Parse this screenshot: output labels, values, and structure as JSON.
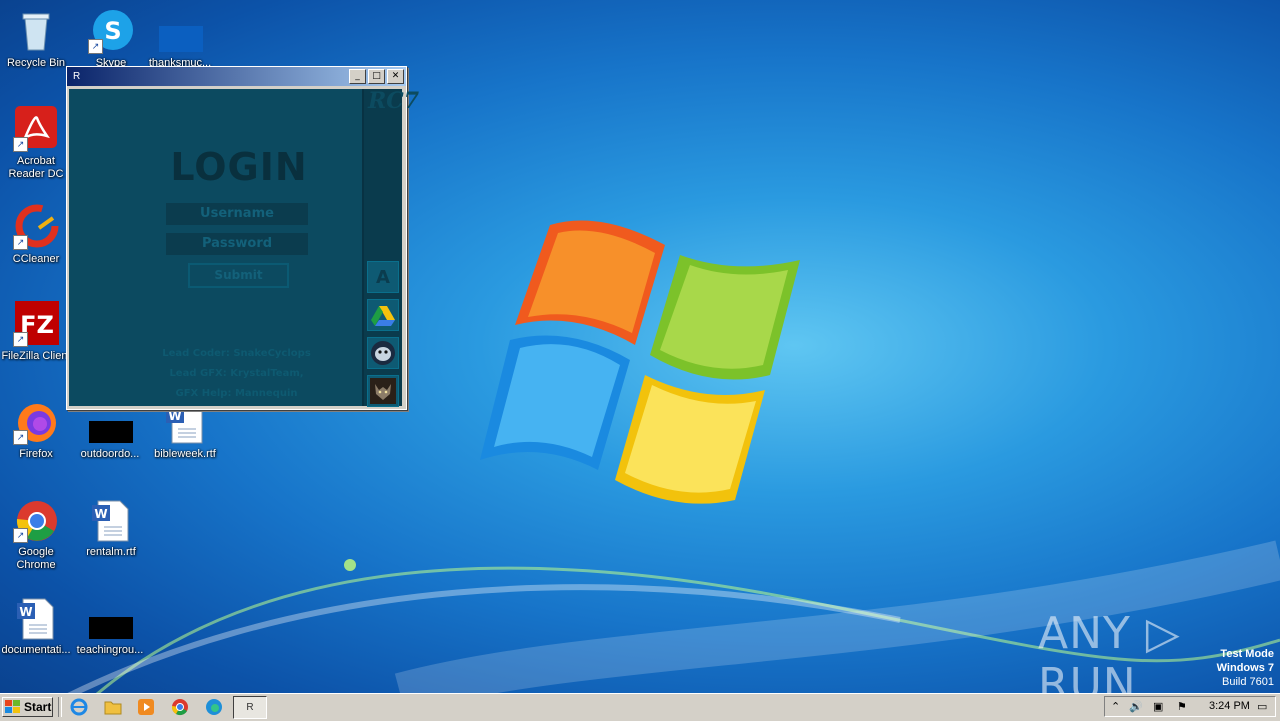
{
  "desktop": {
    "icons": [
      {
        "label": "Recycle Bin"
      },
      {
        "label": "Skype"
      },
      {
        "label": "thanksmuc..."
      },
      {
        "label": "Acrobat Reader DC"
      },
      {
        "label": "CCleaner"
      },
      {
        "label": "FileZilla Client"
      },
      {
        "label": "Firefox"
      },
      {
        "label": "outdoordo..."
      },
      {
        "label": "bibleweek.rtf"
      },
      {
        "label": "Google Chrome"
      },
      {
        "label": "rentalm.rtf"
      },
      {
        "label": "documentati..."
      },
      {
        "label": "teachingrou..."
      }
    ]
  },
  "window": {
    "title": "R",
    "min_label": "_",
    "max_label": "□",
    "close_label": "✕",
    "login_title": "LOGIN",
    "username_placeholder": "Username",
    "password_placeholder": "Password",
    "submit_label": "Submit",
    "credits": [
      "Lead Coder: SnakeCyclops",
      "Lead GFX: KrystalTeam,",
      "GFX Help: Mannequin"
    ],
    "sidebar_logo": "RC7",
    "sidebar_buttons": [
      {
        "label": "A",
        "icon": "letter-a-icon"
      },
      {
        "label": "",
        "icon": "google-drive-icon"
      },
      {
        "label": "",
        "icon": "bird-icon"
      },
      {
        "label": "",
        "icon": "wolf-icon"
      }
    ]
  },
  "watermark": {
    "brand": "ANY ▷ RUN",
    "line1": "Test Mode",
    "line2": "Windows 7",
    "line3": "Build 7601"
  },
  "taskbar": {
    "start_label": "Start",
    "task_label": "R",
    "clock": "3:24 PM"
  }
}
